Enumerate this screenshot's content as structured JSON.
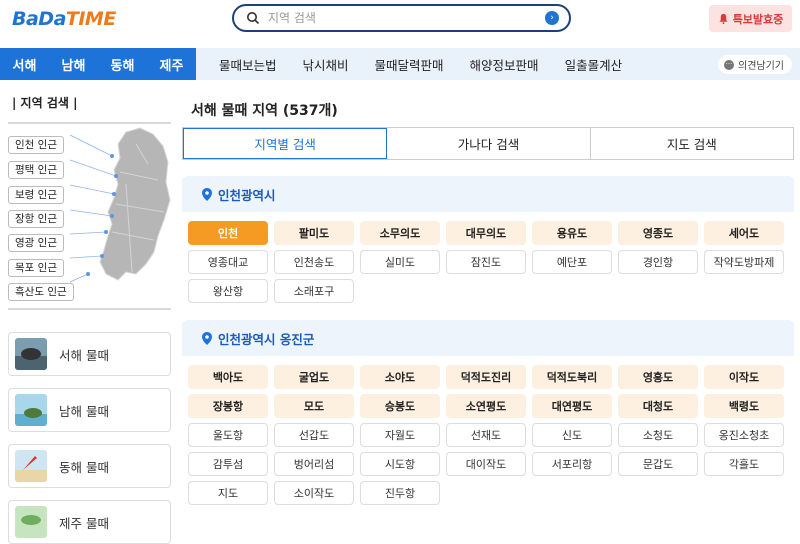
{
  "header": {
    "logo_part1": "BaDa",
    "logo_part2": "TIME",
    "search_placeholder": "지역 검색",
    "alert_button": "특보발효중"
  },
  "nav": {
    "sea_tabs": [
      "서해",
      "남해",
      "동해",
      "제주"
    ],
    "menu": [
      "물때보는법",
      "낚시채비",
      "물때달력판매",
      "해양정보판매",
      "일출몰계산"
    ],
    "feedback": "의견남기기"
  },
  "sidebar": {
    "title": "| 지역 검색 |",
    "map_labels": [
      "인천 인근",
      "평택 인근",
      "보령 인근",
      "장항 인근",
      "영광 인근",
      "목포 인근",
      "흑산도 인근"
    ],
    "sea_cards": [
      "서해 물때",
      "남해 물때",
      "동해 물때",
      "제주 물때"
    ]
  },
  "main": {
    "title": "서해 물때 지역 (537개)",
    "tabs": [
      "지역별 검색",
      "가나다 검색",
      "지도 검색"
    ],
    "regions": [
      {
        "name": "인천광역시",
        "places": [
          {
            "name": "인천",
            "style": "act"
          },
          {
            "name": "팔미도",
            "style": "hl"
          },
          {
            "name": "소무의도",
            "style": "hl"
          },
          {
            "name": "대무의도",
            "style": "hl"
          },
          {
            "name": "용유도",
            "style": "hl"
          },
          {
            "name": "영종도",
            "style": "hl"
          },
          {
            "name": "세어도",
            "style": "hl"
          },
          {
            "name": "영종대교",
            "style": "pl"
          },
          {
            "name": "인천송도",
            "style": "pl"
          },
          {
            "name": "실미도",
            "style": "pl"
          },
          {
            "name": "잠진도",
            "style": "pl"
          },
          {
            "name": "예단포",
            "style": "pl"
          },
          {
            "name": "경인항",
            "style": "pl"
          },
          {
            "name": "작약도방파제",
            "style": "pl"
          },
          {
            "name": "왕산항",
            "style": "pl"
          },
          {
            "name": "소래포구",
            "style": "pl"
          }
        ]
      },
      {
        "name": "인천광역시 옹진군",
        "places": [
          {
            "name": "백아도",
            "style": "hl"
          },
          {
            "name": "굴업도",
            "style": "hl"
          },
          {
            "name": "소야도",
            "style": "hl"
          },
          {
            "name": "덕적도진리",
            "style": "hl"
          },
          {
            "name": "덕적도북리",
            "style": "hl"
          },
          {
            "name": "영흥도",
            "style": "hl"
          },
          {
            "name": "이작도",
            "style": "hl"
          },
          {
            "name": "장봉항",
            "style": "hl"
          },
          {
            "name": "모도",
            "style": "hl"
          },
          {
            "name": "승봉도",
            "style": "hl"
          },
          {
            "name": "소연평도",
            "style": "hl"
          },
          {
            "name": "대연평도",
            "style": "hl"
          },
          {
            "name": "대청도",
            "style": "hl"
          },
          {
            "name": "백령도",
            "style": "hl"
          },
          {
            "name": "울도항",
            "style": "pl"
          },
          {
            "name": "선갑도",
            "style": "pl"
          },
          {
            "name": "자월도",
            "style": "pl"
          },
          {
            "name": "선재도",
            "style": "pl"
          },
          {
            "name": "신도",
            "style": "pl"
          },
          {
            "name": "소청도",
            "style": "pl"
          },
          {
            "name": "옹진소청초",
            "style": "pl"
          },
          {
            "name": "감투섬",
            "style": "pl"
          },
          {
            "name": "벙어리섬",
            "style": "pl"
          },
          {
            "name": "시도항",
            "style": "pl"
          },
          {
            "name": "대이작도",
            "style": "pl"
          },
          {
            "name": "서포리항",
            "style": "pl"
          },
          {
            "name": "문갑도",
            "style": "pl"
          },
          {
            "name": "각흘도",
            "style": "pl"
          },
          {
            "name": "지도",
            "style": "pl"
          },
          {
            "name": "소이작도",
            "style": "pl"
          },
          {
            "name": "진두항",
            "style": "pl"
          }
        ]
      }
    ]
  },
  "colors": {
    "brand_blue": "#1e73d9",
    "brand_orange": "#f07a1a",
    "chip_active": "#f59a23",
    "chip_highlight": "#fdf0e0",
    "alert_bg": "#fde2e2"
  }
}
